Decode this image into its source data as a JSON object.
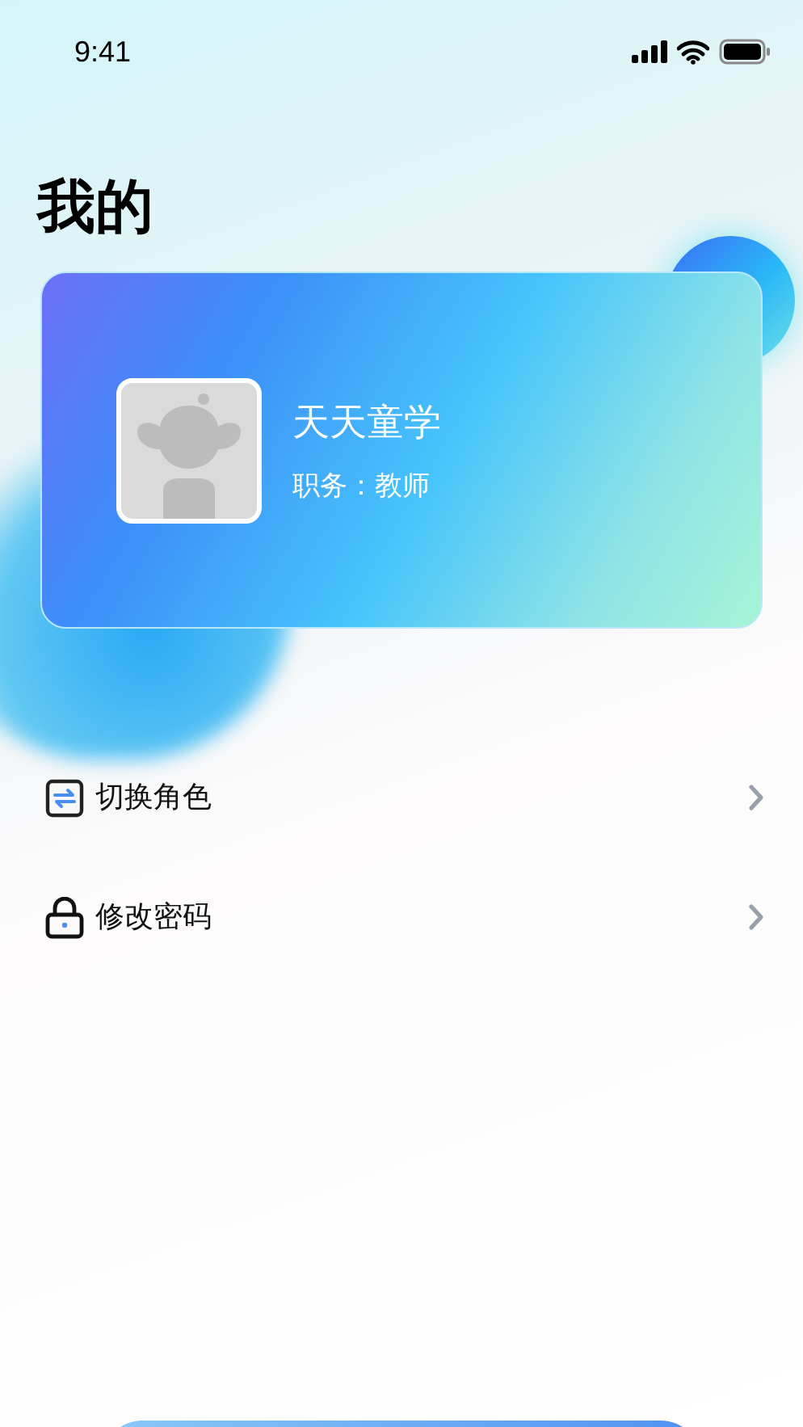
{
  "status_bar": {
    "time": "9:41"
  },
  "title": "我的",
  "profile": {
    "name": "天天童学",
    "role": "职务：教师"
  },
  "menu": [
    {
      "label": "切换角色"
    },
    {
      "label": "修改密码"
    }
  ]
}
